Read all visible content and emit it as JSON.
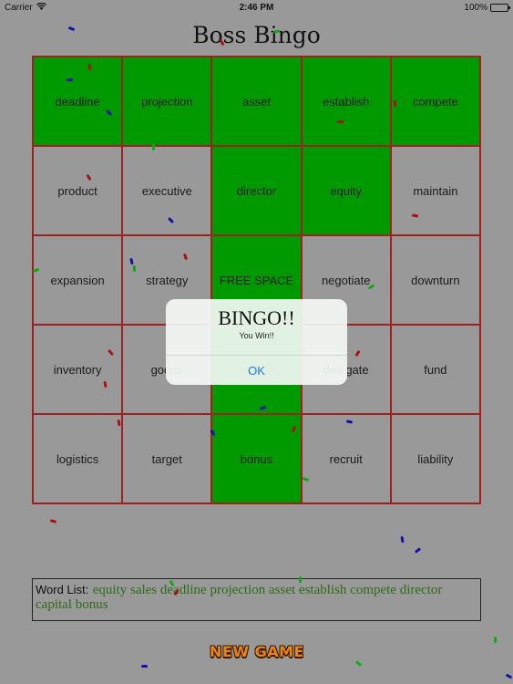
{
  "status_bar": {
    "carrier": "Carrier",
    "time": "2:46 PM",
    "battery": "100%",
    "battery_level": 1.0
  },
  "title": "Boss Bingo",
  "colors": {
    "background": "#999999",
    "marked_cell": "#009900",
    "grid_border": "#a02020",
    "word_list_text": "#2e6b1a",
    "alert_button": "#1a7ee0"
  },
  "board": {
    "cells": [
      {
        "word": "deadline",
        "marked": true
      },
      {
        "word": "projection",
        "marked": true
      },
      {
        "word": "asset",
        "marked": true
      },
      {
        "word": "establish",
        "marked": true
      },
      {
        "word": "compete",
        "marked": true
      },
      {
        "word": "product",
        "marked": false
      },
      {
        "word": "executive",
        "marked": false
      },
      {
        "word": "director",
        "marked": true
      },
      {
        "word": "equity",
        "marked": true
      },
      {
        "word": "maintain",
        "marked": false
      },
      {
        "word": "expansion",
        "marked": false
      },
      {
        "word": "strategy",
        "marked": false
      },
      {
        "word": "FREE SPACE",
        "marked": true
      },
      {
        "word": "negotiate",
        "marked": false
      },
      {
        "word": "downturn",
        "marked": false
      },
      {
        "word": "inventory",
        "marked": false
      },
      {
        "word": "goods",
        "marked": false
      },
      {
        "word": "capital",
        "marked": true
      },
      {
        "word": "delegate",
        "marked": false
      },
      {
        "word": "fund",
        "marked": false
      },
      {
        "word": "logistics",
        "marked": false
      },
      {
        "word": "target",
        "marked": false
      },
      {
        "word": "bonus",
        "marked": true
      },
      {
        "word": "recruit",
        "marked": false
      },
      {
        "word": "liability",
        "marked": false
      }
    ]
  },
  "word_list": {
    "label": "Word List:",
    "words": "equity sales deadline projection asset establish compete director capital bonus"
  },
  "new_game_label": "NEW GAME",
  "alert": {
    "title": "BINGO!!",
    "message": "You Win!!",
    "ok_label": "OK"
  }
}
